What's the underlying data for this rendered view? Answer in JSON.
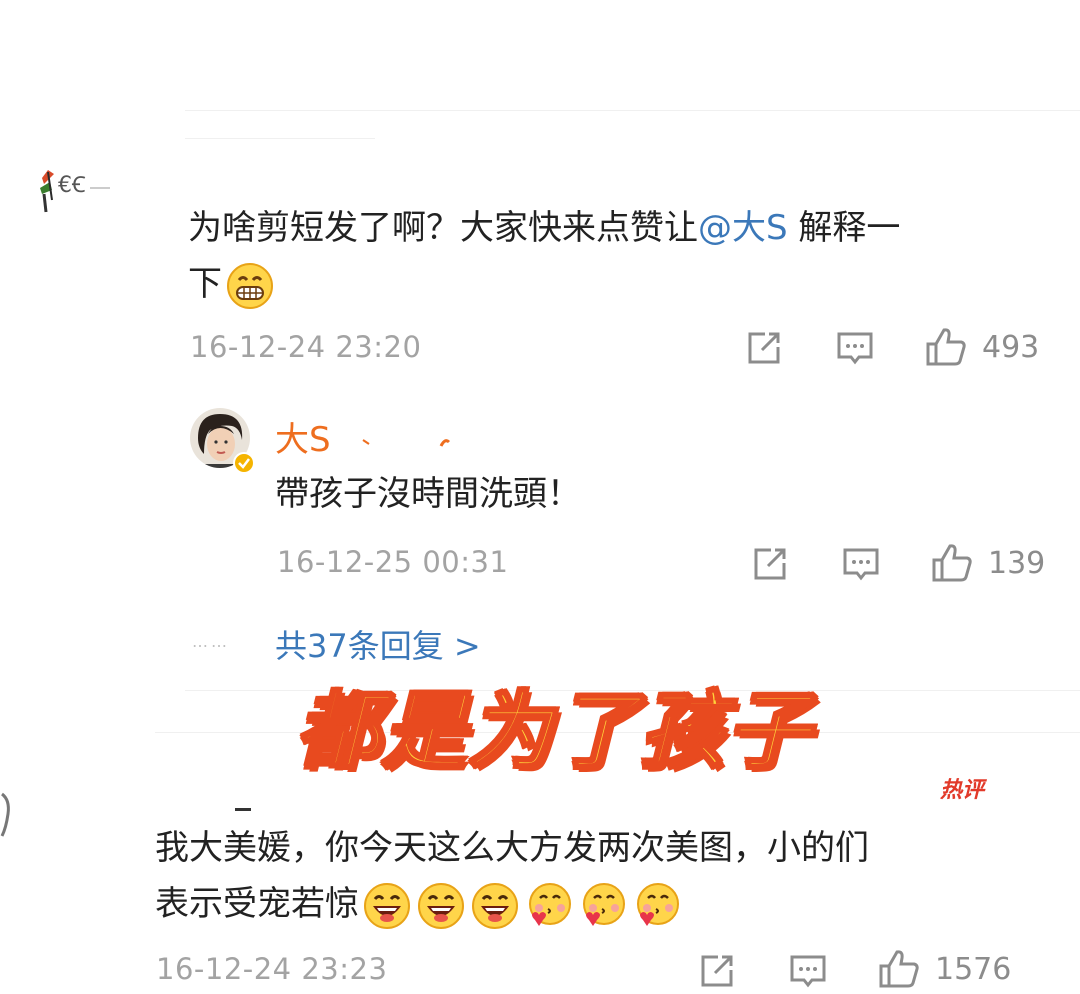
{
  "comment1": {
    "text_before": "为啥剪短发了啊？大家快来点赞让",
    "mention": "@大S",
    "text_after": " 解释一",
    "text_line2": "下",
    "time": "16-12-24 23:20",
    "likes": "493"
  },
  "reply": {
    "name": "大S",
    "text": "帶孩子沒時間洗頭！",
    "time": "16-12-25 00:31",
    "likes": "139"
  },
  "more_replies": "共37条回复 >",
  "more_dots": "……",
  "overlay": "都是为了孩子",
  "comment2": {
    "badge": "热评",
    "text_line1": "我大美媛，你今天这么大方发两次美图，小的们",
    "text_line2": "表示受宠若惊",
    "time": "16-12-24 23:23",
    "likes": "1576"
  },
  "colors": {
    "mention": "#3b78b9",
    "reply_name": "#ee6e1f",
    "overlay_fill": "#ffd43b",
    "overlay_stroke": "#e84a1f",
    "hot_badge": "#e23a2a"
  },
  "icons": [
    "share-icon",
    "comment-icon",
    "like-icon",
    "grin-emoji",
    "laugh-emoji",
    "kiss-emoji",
    "verified-icon"
  ]
}
